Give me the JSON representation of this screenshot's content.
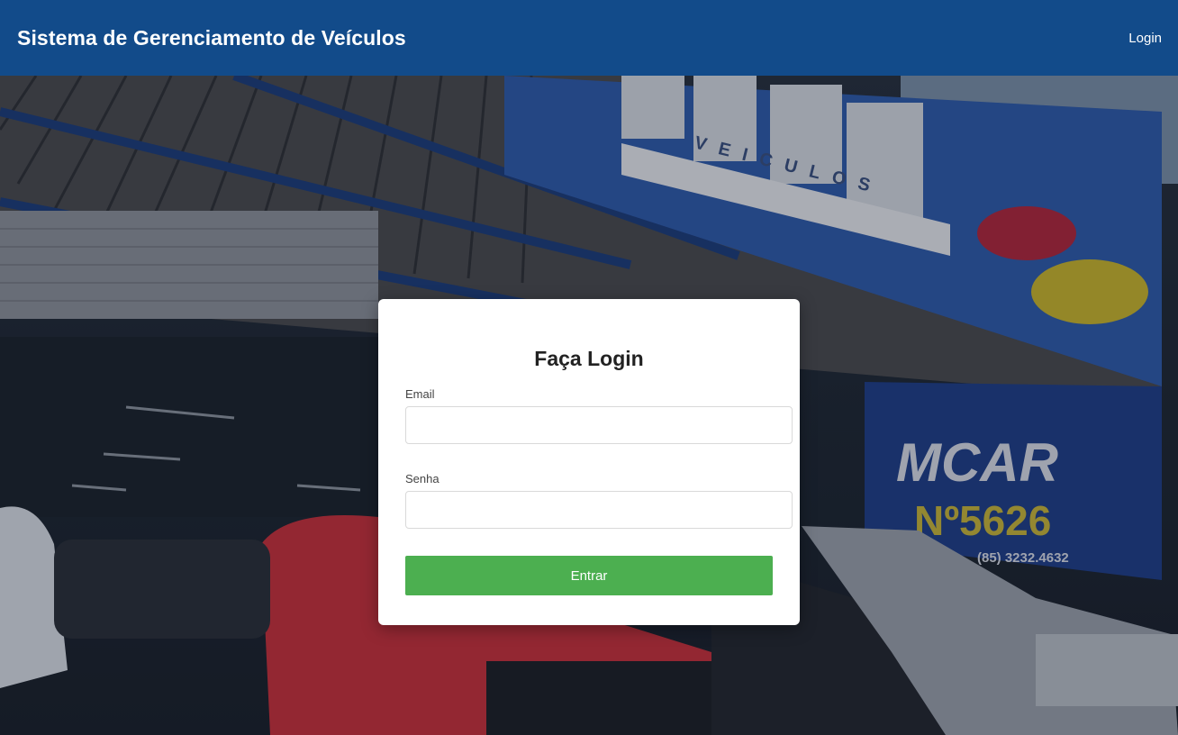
{
  "header": {
    "title": "Sistema de Gerenciamento de Veículos",
    "login_link": "Login",
    "background_color": "#124b8a"
  },
  "background": {
    "sign_brand": "MCAR",
    "sign_subtitle": "VEICULOS",
    "sign_number": "Nº5626",
    "sign_phone": "(85) 3232.4632"
  },
  "login_form": {
    "title": "Faça Login",
    "email_label": "Email",
    "email_value": "",
    "password_label": "Senha",
    "password_value": "",
    "submit_label": "Entrar",
    "submit_color": "#4caf50"
  }
}
